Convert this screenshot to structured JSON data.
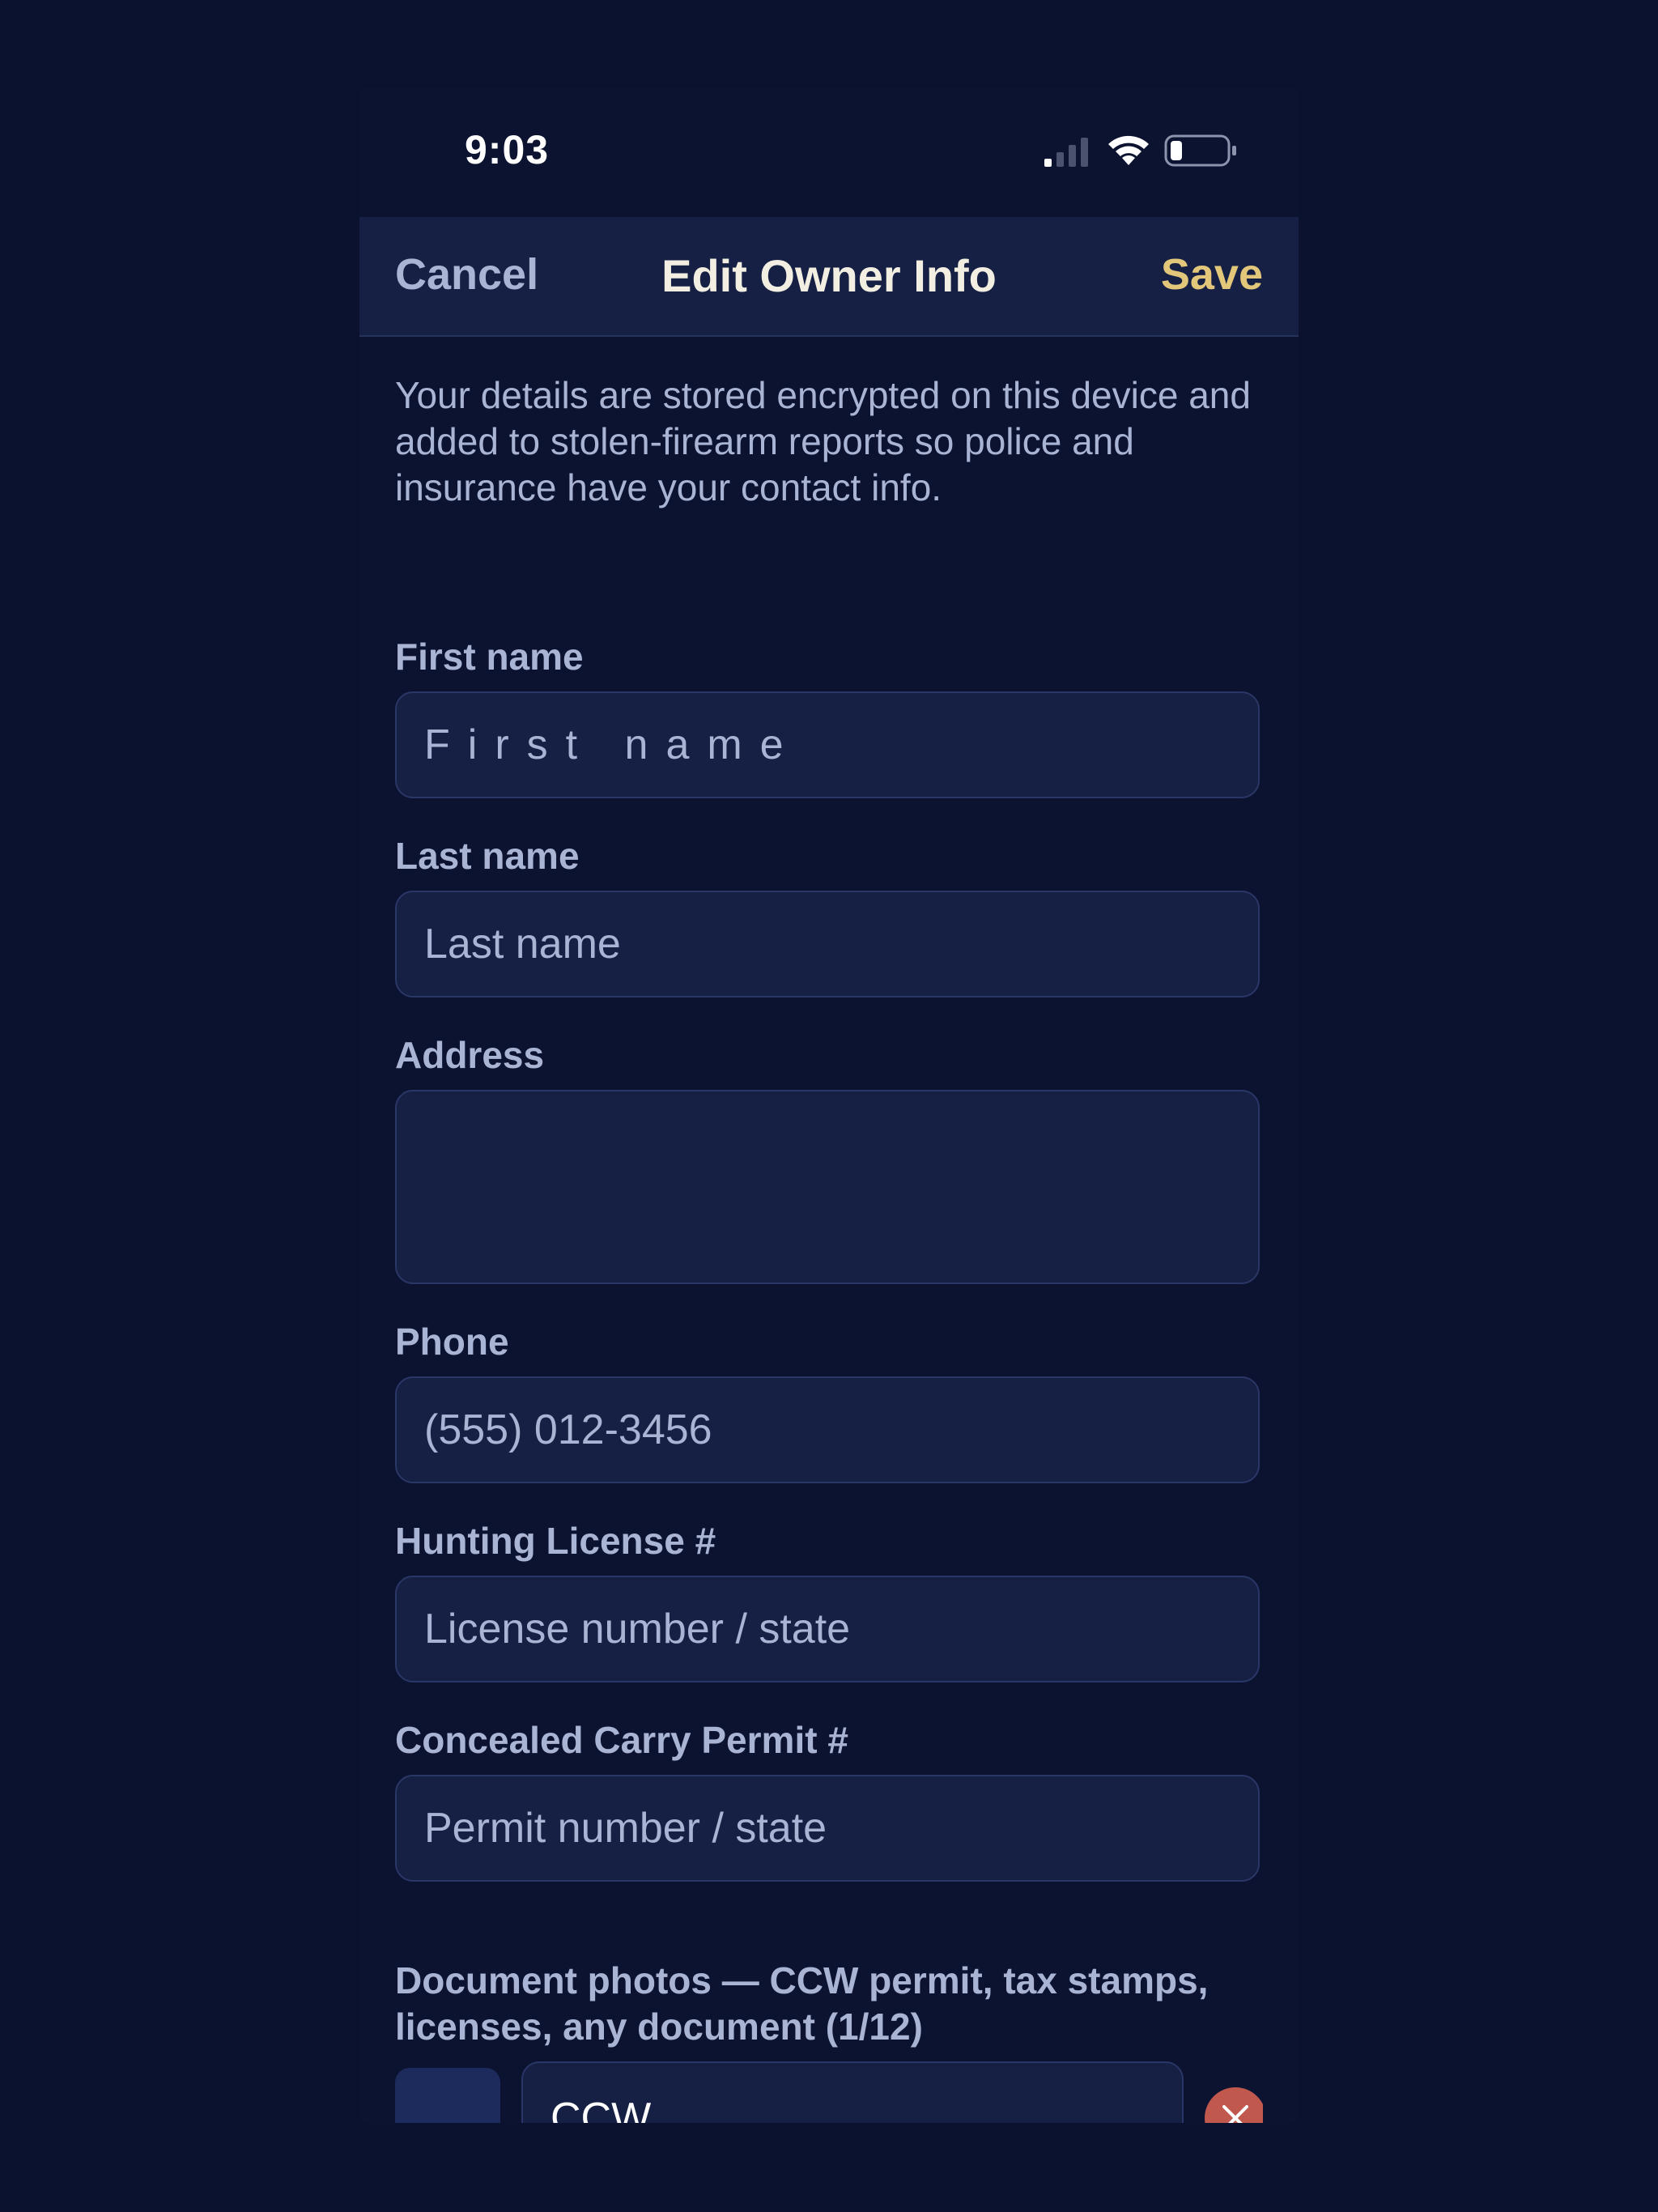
{
  "status_bar": {
    "time": "9:03"
  },
  "nav": {
    "cancel_label": "Cancel",
    "title": "Edit Owner Info",
    "save_label": "Save"
  },
  "intro_text": "Your details are stored encrypted on this device and added to stolen-firearm reports so police and insurance have your contact info.",
  "fields": {
    "first_name": {
      "label": "First name",
      "placeholder": "First name",
      "value": ""
    },
    "last_name": {
      "label": "Last name",
      "placeholder": "Last name",
      "value": ""
    },
    "address": {
      "label": "Address",
      "placeholder": "",
      "value": ""
    },
    "phone": {
      "label": "Phone",
      "placeholder": "(555) 012-3456",
      "value": ""
    },
    "hunting_license": {
      "label": "Hunting License #",
      "placeholder": "License number / state",
      "value": ""
    },
    "ccw_permit": {
      "label": "Concealed Carry Permit #",
      "placeholder": "Permit number / state",
      "value": ""
    }
  },
  "documents": {
    "label": "Document photos — CCW permit, tax stamps, licenses, any document (1/12)",
    "items": [
      {
        "name": "CCW"
      }
    ]
  },
  "colors": {
    "background": "#0a1230",
    "surface": "#162044",
    "accent_save": "#e2c67a",
    "muted_text": "#a9b3d3",
    "remove_button": "#c0584e"
  },
  "icons": {
    "signal": "signal-icon",
    "wifi": "wifi-icon",
    "battery": "battery-icon",
    "remove": "close-icon"
  }
}
